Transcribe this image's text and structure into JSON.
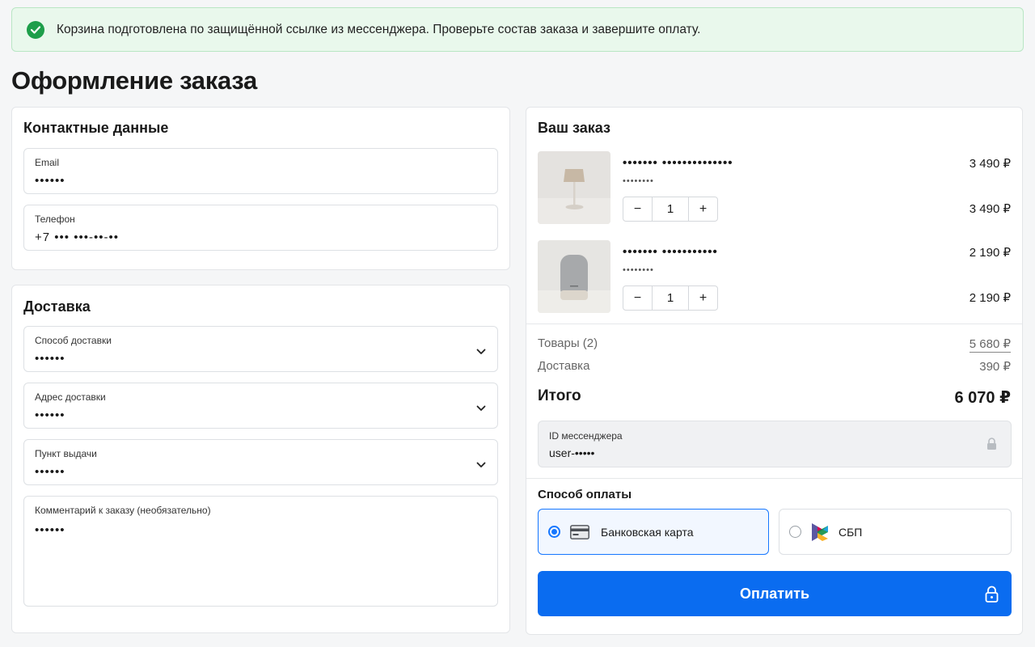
{
  "banner": {
    "text": "Корзина подготовлена по защищённой ссылке из мессенджера. Проверьте состав заказа и завершите оплату."
  },
  "page_title": "Оформление заказа",
  "contacts": {
    "title": "Контактные данные",
    "email": {
      "label": "Email",
      "value": "••••••"
    },
    "phone": {
      "label": "Телефон",
      "value": "+7 ••• •••-••-••"
    }
  },
  "delivery": {
    "title": "Доставка",
    "method": {
      "label": "Способ доставки",
      "value": "••••••"
    },
    "address": {
      "label": "Адрес доставки",
      "value": "••••••"
    },
    "pickup": {
      "label": "Пункт выдачи",
      "value": "••••••"
    },
    "comment": {
      "label": "Комментарий к заказу (необязательно)",
      "value": "••••••"
    }
  },
  "order": {
    "title": "Ваш заказ",
    "items": [
      {
        "name": "••••••• ••••••••••••••",
        "sub": "••••••••",
        "price": "3 490 ₽",
        "qty": "1",
        "total": "3 490 ₽",
        "image": "table-lamp-image"
      },
      {
        "name": "••••••• •••••••••••",
        "sub": "••••••••",
        "price": "2 190 ₽",
        "qty": "1",
        "total": "2 190 ₽",
        "image": "smart-speaker-image"
      }
    ],
    "qty_minus": "−",
    "qty_plus": "+",
    "goods_label": "Товары (2)",
    "goods_value": "5 680 ₽",
    "delivery_label": "Доставка",
    "delivery_value": "390 ₽",
    "total_label": "Итого",
    "total_value": "6 070 ₽",
    "messenger_id": {
      "label": "ID мессенджера",
      "value": "user-•••••"
    },
    "payment_title": "Способ оплаты",
    "payment_options": [
      {
        "label": "Банковская карта",
        "selected": true,
        "icon": "bank-card-icon"
      },
      {
        "label": "СБП",
        "selected": false,
        "icon": "sbp-logo-icon"
      }
    ],
    "pay_button": "Оплатить"
  },
  "colors": {
    "accent": "#0a6cf0",
    "success": "#1e9e4a",
    "banner_bg": "#e9f8ec"
  }
}
